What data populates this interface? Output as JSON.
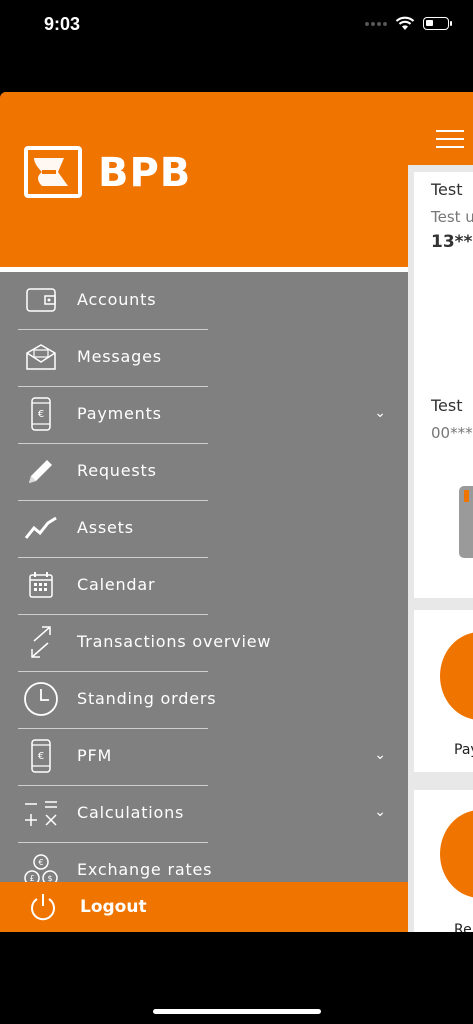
{
  "status_bar": {
    "time": "9:03"
  },
  "brand": {
    "name": "BPB",
    "accent": "#f07400",
    "drawer_bg": "#808080"
  },
  "menu": [
    {
      "label": "Accounts",
      "icon": "wallet-icon",
      "has_chevron": false
    },
    {
      "label": "Messages",
      "icon": "mail-icon",
      "has_chevron": false
    },
    {
      "label": "Payments",
      "icon": "phone-euro-icon",
      "has_chevron": true
    },
    {
      "label": "Requests",
      "icon": "pencil-icon",
      "has_chevron": false
    },
    {
      "label": "Assets",
      "icon": "trend-line-icon",
      "has_chevron": false
    },
    {
      "label": "Calendar",
      "icon": "calendar-icon",
      "has_chevron": false
    },
    {
      "label": "Transactions overview",
      "icon": "arrows-diagonal-icon",
      "has_chevron": false
    },
    {
      "label": "Standing orders",
      "icon": "clock-icon",
      "has_chevron": false
    },
    {
      "label": "PFM",
      "icon": "phone-euro-icon",
      "has_chevron": true
    },
    {
      "label": "Calculations",
      "icon": "calculator-signs-icon",
      "has_chevron": true
    },
    {
      "label": "Exchange rates",
      "icon": "currency-coins-icon",
      "has_chevron": false
    }
  ],
  "logout": {
    "label": "Logout"
  },
  "content": {
    "cards": [
      {
        "title": "Test",
        "subtitle": "Test u",
        "number": "13***"
      },
      {
        "title": "Test",
        "subtitle": "00***"
      },
      {
        "label": "Pay"
      },
      {
        "label": "Re"
      }
    ]
  }
}
